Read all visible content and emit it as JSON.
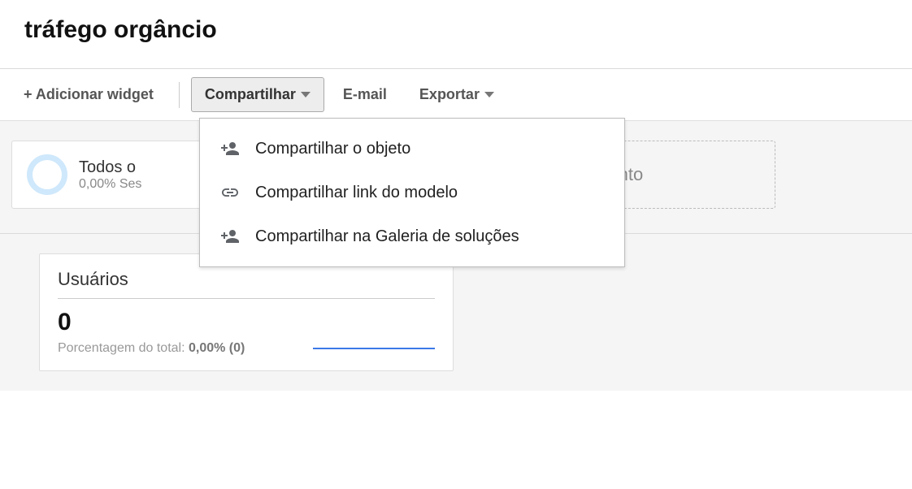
{
  "page": {
    "title": "tráfego orgâncio"
  },
  "toolbar": {
    "add_widget": "+ Adicionar widget",
    "share": "Compartilhar",
    "email": "E-mail",
    "export": "Exportar"
  },
  "share_menu": {
    "share_object": "Compartilhar o objeto",
    "share_template_link": "Compartilhar link do modelo",
    "share_gallery": "Compartilhar na Galeria de soluções"
  },
  "segments": {
    "all_users_title": "Todos o",
    "all_users_sub": "0,00% Ses",
    "add_segment": "+ Adicionar segmento"
  },
  "widget": {
    "title": "Usuários",
    "value": "0",
    "percent_label": "Porcentagem do total: ",
    "percent_value": "0,00% (0)"
  }
}
